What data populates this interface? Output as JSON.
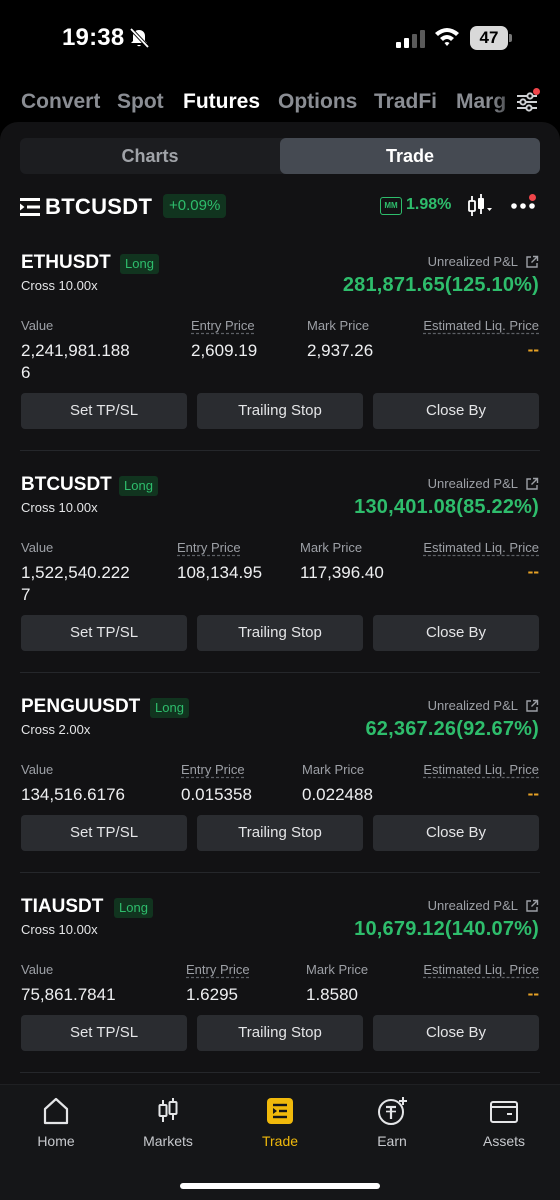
{
  "status_bar": {
    "time": "19:38",
    "battery": "47"
  },
  "top_tabs": [
    "Convert",
    "Spot",
    "Futures",
    "Options",
    "TradFi",
    "Marg"
  ],
  "segment": {
    "charts": "Charts",
    "trade": "Trade"
  },
  "symbol_bar": {
    "symbol": "BTCUSDT",
    "change": "+0.09%",
    "mm_badge": "MM",
    "mm_value": "1.98%"
  },
  "labels": {
    "unrealized_pnl": "Unrealized P&L",
    "value": "Value",
    "entry_price": "Entry Price",
    "mark_price": "Mark Price",
    "est_liq_price": "Estimated Liq. Price",
    "set_tpsl": "Set TP/SL",
    "trailing_stop": "Trailing Stop",
    "close_by": "Close By"
  },
  "positions": [
    {
      "symbol": "ETHUSDT",
      "side": "Long",
      "margin": "Cross 10.00x",
      "pnl": "281,871.65(125.10%)",
      "value_line1": "2,241,981.188",
      "value_line2": "6",
      "entry_price": "2,609.19",
      "mark_price": "2,937.26",
      "liq_price": "--"
    },
    {
      "symbol": "BTCUSDT",
      "side": "Long",
      "margin": "Cross 10.00x",
      "pnl": "130,401.08(85.22%)",
      "value_line1": "1,522,540.222",
      "value_line2": "7",
      "entry_price": "108,134.95",
      "mark_price": "117,396.40",
      "liq_price": "--"
    },
    {
      "symbol": "PENGUUSDT",
      "side": "Long",
      "margin": "Cross 2.00x",
      "pnl": "62,367.26(92.67%)",
      "value_line1": "134,516.6176",
      "value_line2": "",
      "entry_price": "0.015358",
      "mark_price": "0.022488",
      "liq_price": "--"
    },
    {
      "symbol": "TIAUSDT",
      "side": "Long",
      "margin": "Cross 10.00x",
      "pnl": "10,679.12(140.07%)",
      "value_line1": "75,861.7841",
      "value_line2": "",
      "entry_price": "1.6295",
      "mark_price": "1.8580",
      "liq_price": "--"
    }
  ],
  "bottom_nav": [
    {
      "label": "Home",
      "icon": "home-icon"
    },
    {
      "label": "Markets",
      "icon": "candlestick-icon"
    },
    {
      "label": "Trade",
      "icon": "trade-icon"
    },
    {
      "label": "Earn",
      "icon": "tether-coin-icon"
    },
    {
      "label": "Assets",
      "icon": "wallet-icon"
    }
  ],
  "colors": {
    "green": "#2ebd6c",
    "orange": "#e7a125",
    "accent": "#f0b90b",
    "notification": "#f0454a"
  }
}
